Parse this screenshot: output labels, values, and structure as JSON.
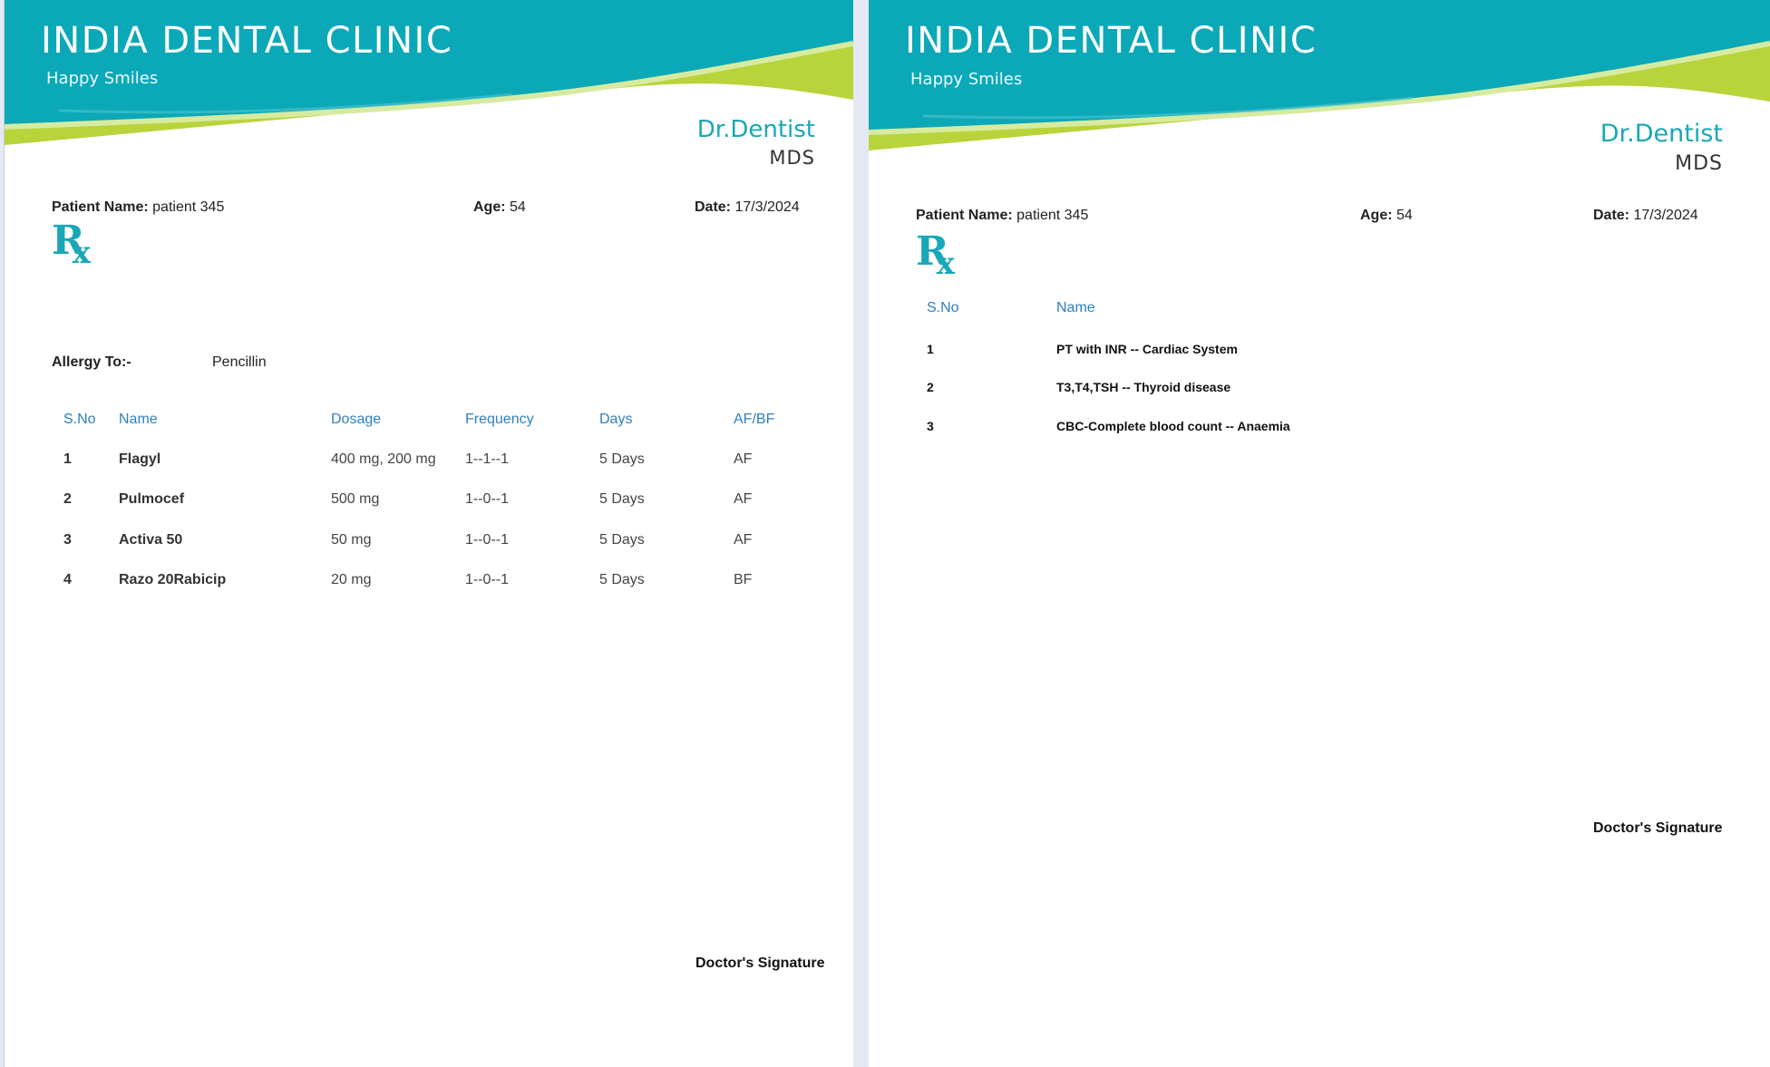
{
  "clinic": {
    "name": "INDIA DENTAL CLINIC",
    "tagline": "Happy Smiles",
    "doctor": "Dr.Dentist",
    "degree": "MDS"
  },
  "colors": {
    "teal": "#0ba8b8",
    "lime": "#b8d43a",
    "header_blue": "#2d7fc1"
  },
  "labels": {
    "patient_name": "Patient Name:",
    "age": "Age:",
    "date": "Date:",
    "allergy": "Allergy To:-",
    "signature": "Doctor's Signature",
    "rx_r": "R",
    "rx_x": "x"
  },
  "patient": {
    "name": "patient 345",
    "age": "54",
    "date": "17/3/2024"
  },
  "allergy": "Pencillin",
  "prescription": {
    "headers": [
      "S.No",
      "Name",
      "Dosage",
      "Frequency",
      "Days",
      "AF/BF"
    ],
    "rows": [
      [
        "1",
        "Flagyl",
        "400 mg, 200 mg",
        "1--1--1",
        "5 Days",
        "AF"
      ],
      [
        "2",
        "Pulmocef",
        "500 mg",
        "1--0--1",
        "5 Days",
        "AF"
      ],
      [
        "3",
        "Activa 50",
        "50 mg",
        "1--0--1",
        "5 Days",
        "AF"
      ],
      [
        "4",
        "Razo 20Rabicip",
        "20 mg",
        "1--0--1",
        "5 Days",
        "BF"
      ]
    ]
  },
  "tests": {
    "headers": [
      "S.No",
      "Name"
    ],
    "rows": [
      [
        "1",
        "PT with INR -- Cardiac System"
      ],
      [
        "2",
        "T3,T4,TSH -- Thyroid disease"
      ],
      [
        "3",
        "CBC-Complete blood count -- Anaemia"
      ]
    ]
  }
}
